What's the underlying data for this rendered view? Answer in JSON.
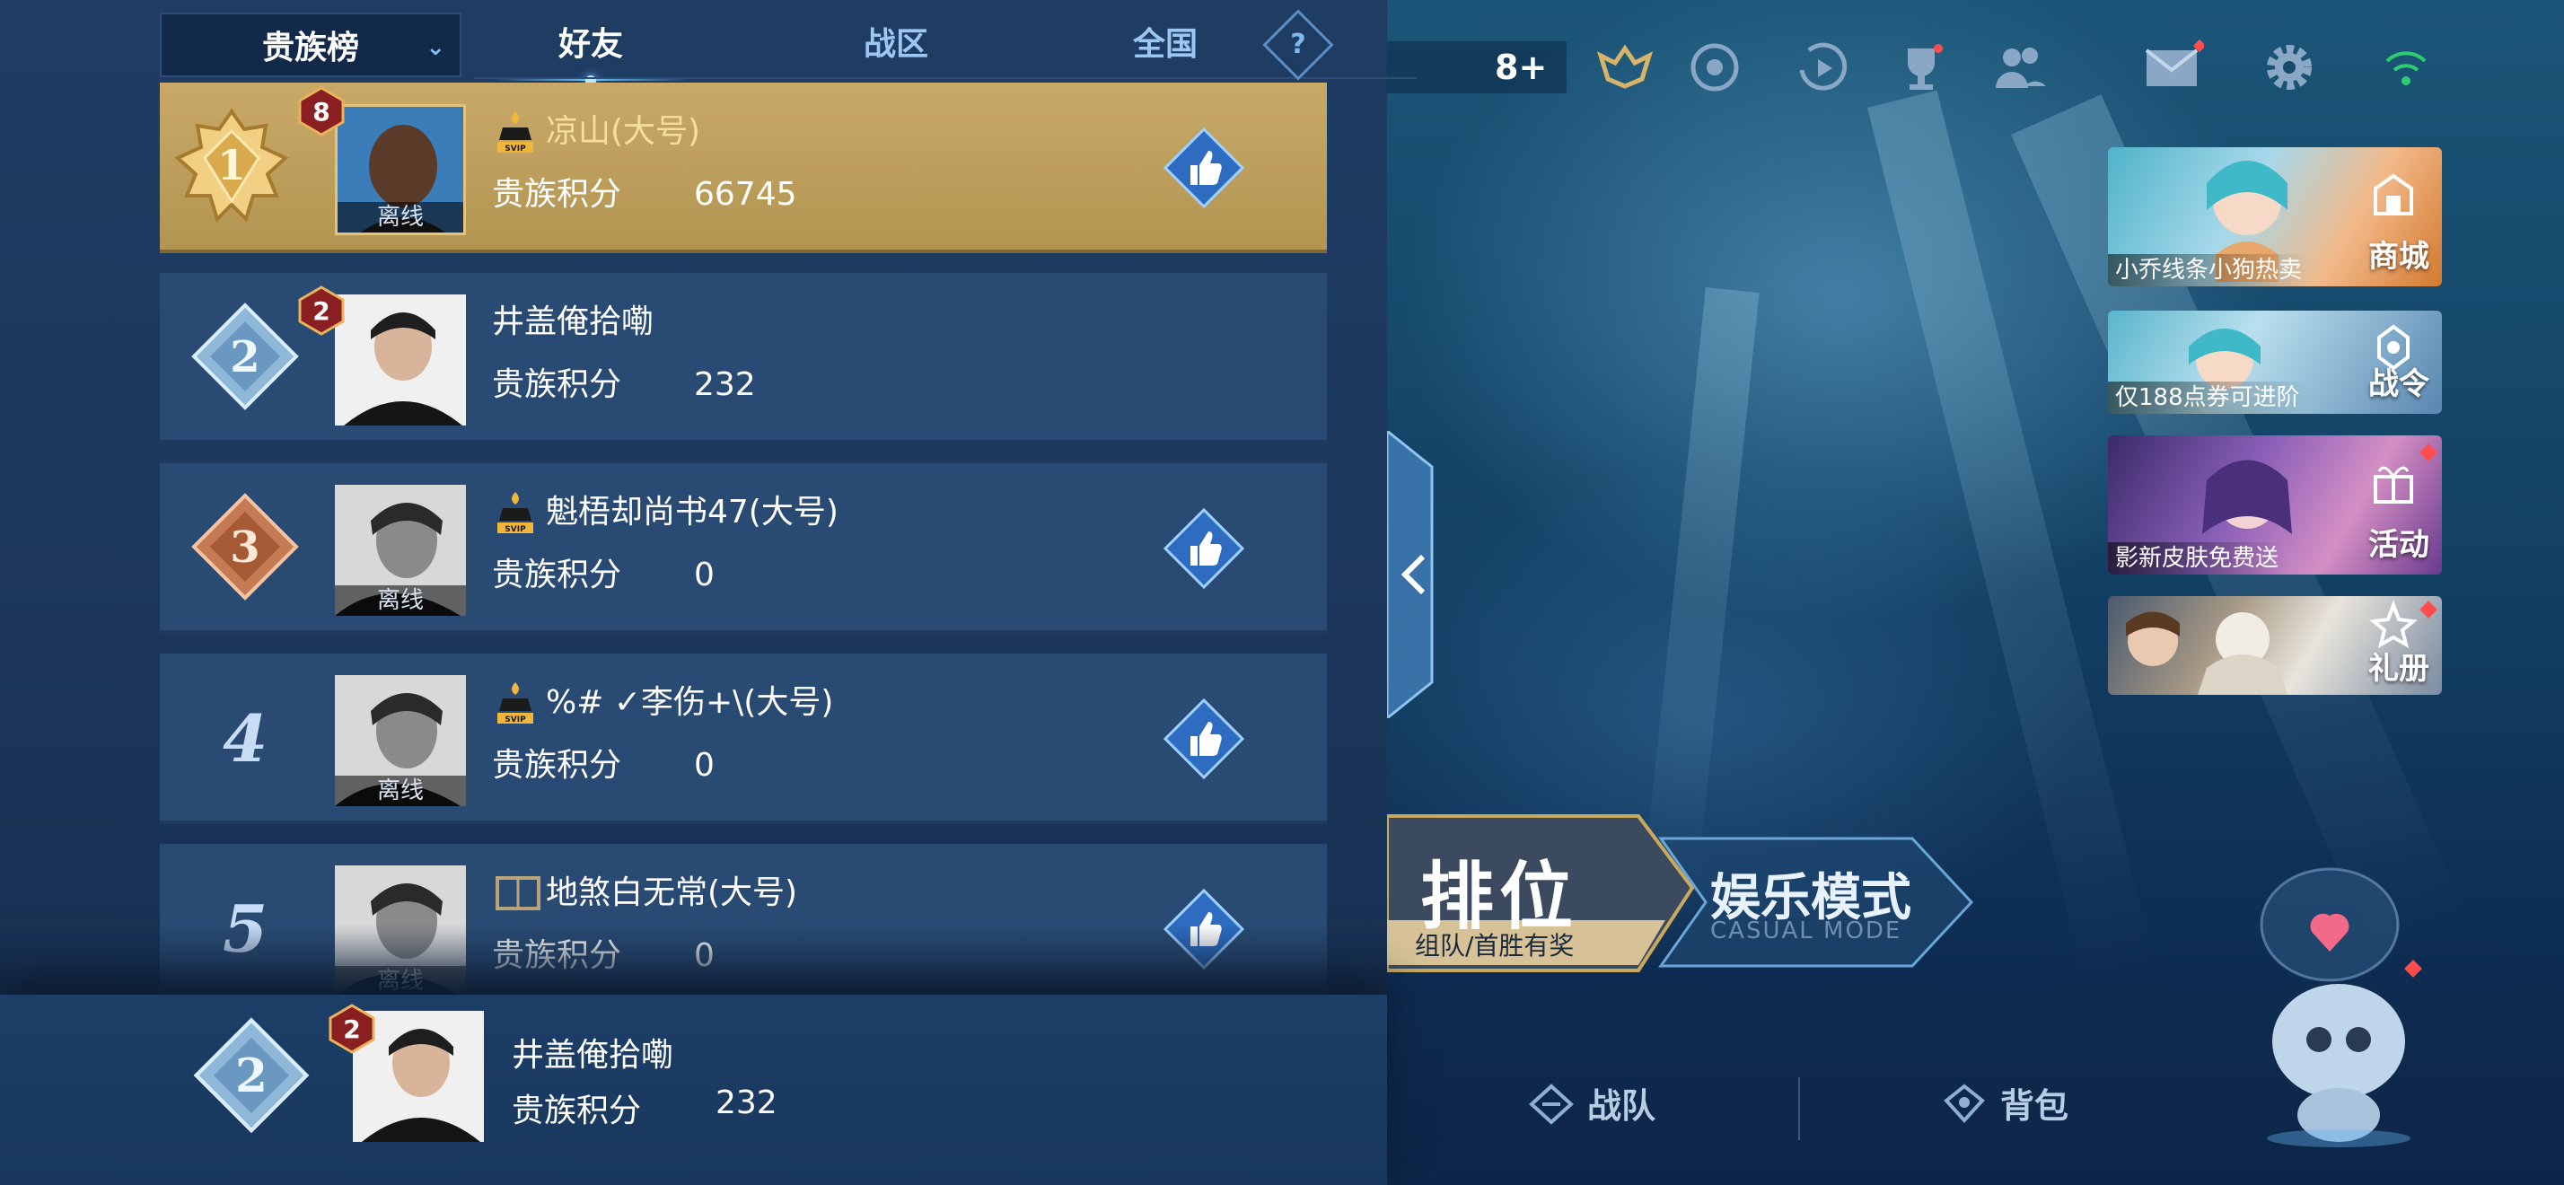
{
  "leaderboard": {
    "category": "贵族榜",
    "tabs": {
      "friends": "好友",
      "zone": "战区",
      "national": "全国"
    },
    "help_label": "?",
    "score_label": "贵族积分",
    "offline_label": "离线",
    "rows": [
      {
        "rank": "1",
        "level": "8",
        "name": "凉山(大号)",
        "score": "66745",
        "vip": true,
        "offline": true,
        "like": true
      },
      {
        "rank": "2",
        "level": "2",
        "name": "井盖俺拾嘞",
        "score": "232",
        "vip": false,
        "offline": false,
        "like": false
      },
      {
        "rank": "3",
        "level": "",
        "name": "魁梧却尚书47(大号)",
        "score": "0",
        "vip": true,
        "offline": true,
        "like": true
      },
      {
        "rank": "4",
        "level": "",
        "name": "%# ✓李伤+\\(大号)",
        "score": "0",
        "vip": true,
        "offline": true,
        "like": true
      },
      {
        "rank": "5",
        "level": "",
        "name": "地煞白无常(大号)",
        "score": "0",
        "vip": false,
        "offline": true,
        "like": true
      }
    ],
    "self": {
      "rank": "2",
      "level": "2",
      "name": "井盖俺拾嘞",
      "score": "232"
    }
  },
  "topbar": {
    "plus_count": "8"
  },
  "promos": [
    {
      "caption": "小乔线条小狗热卖",
      "label": "商城"
    },
    {
      "caption": "仅188点券可进阶",
      "label": "战令"
    },
    {
      "caption": "影新皮肤免费送",
      "label": "活动"
    },
    {
      "caption": "",
      "label": "礼册"
    }
  ],
  "modes": {
    "ranked_title": "排位",
    "ranked_sub": "组队/首胜有奖",
    "casual_title": "娱乐模式",
    "casual_sub": "CASUAL MODE"
  },
  "bottom_nav": {
    "team": "战队",
    "bag": "背包"
  },
  "colors": {
    "gold_row": "#c8a968",
    "row": "#294a73",
    "accent": "#66c2ff"
  }
}
